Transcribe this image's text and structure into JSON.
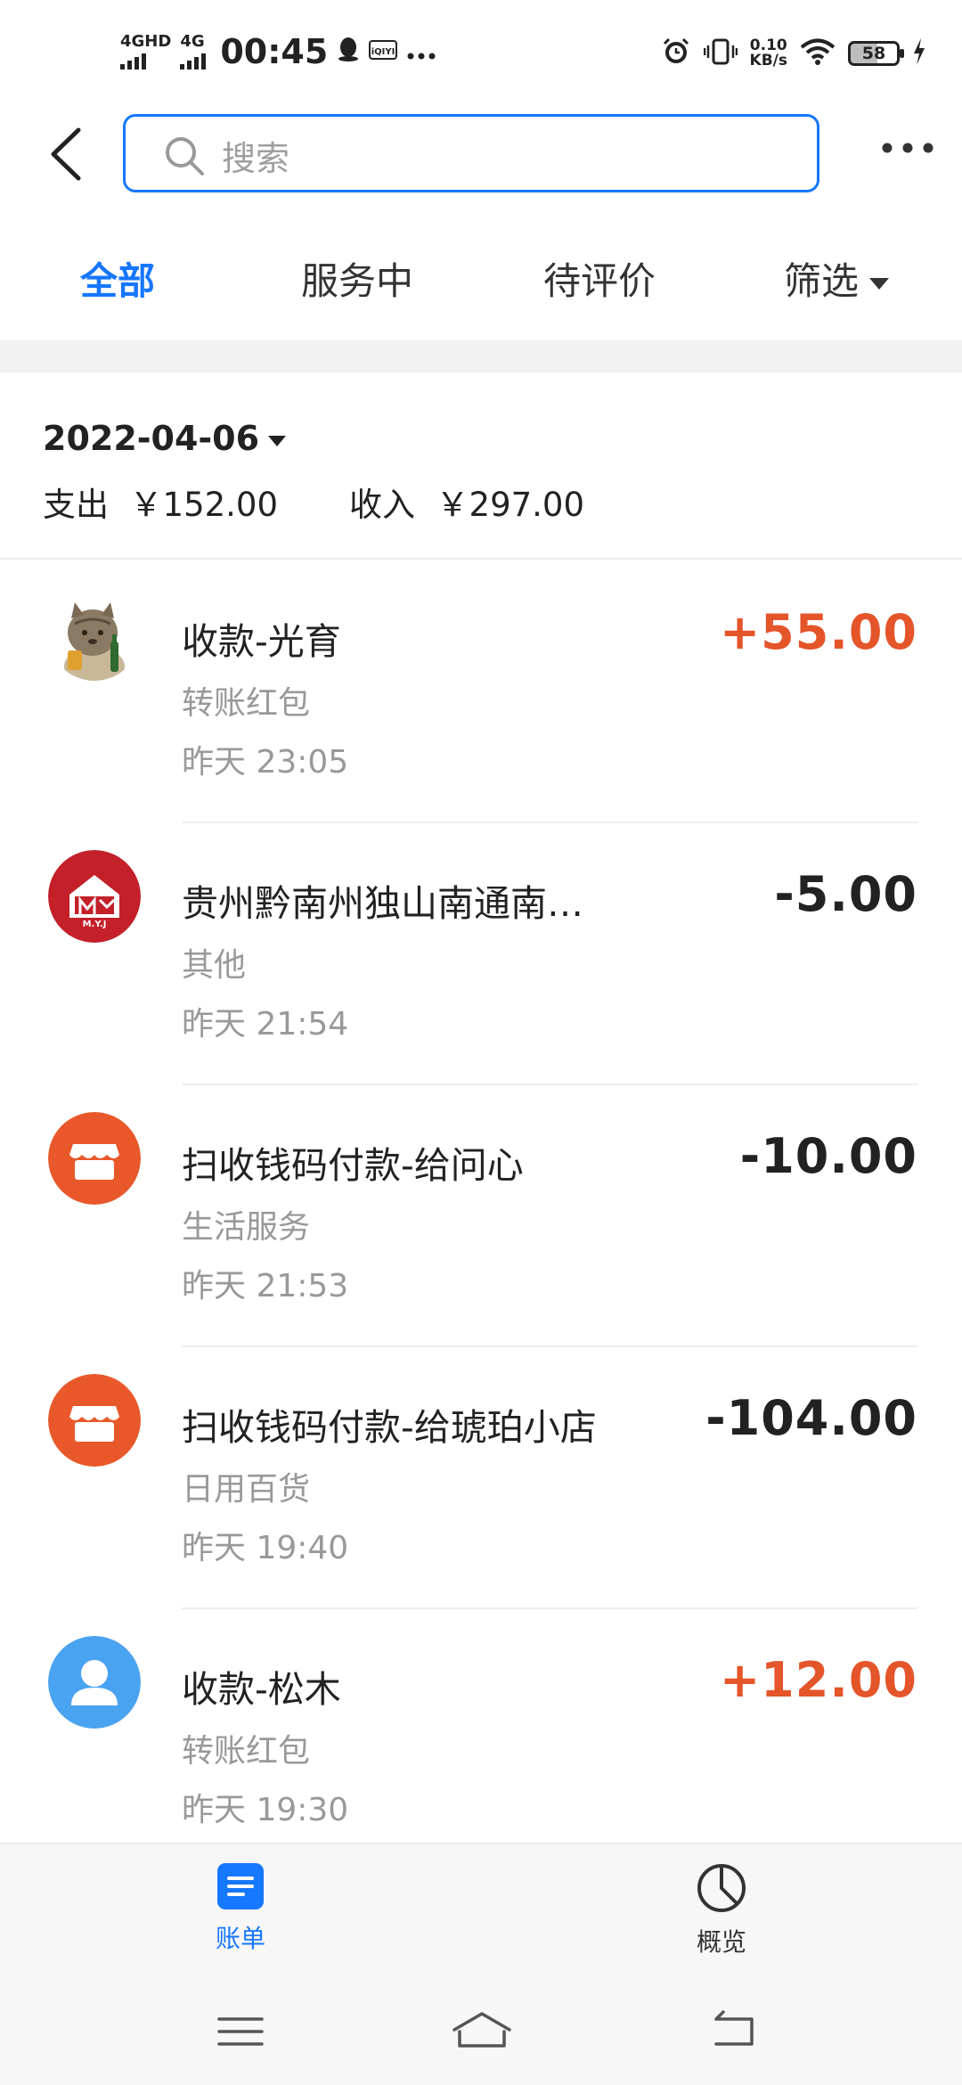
{
  "status_bar": {
    "net1": "4GHD",
    "net2": "4G",
    "time": "00:45",
    "speed_top": "0.10",
    "speed_bottom": "KB/s",
    "battery": "58"
  },
  "search": {
    "placeholder": "搜索"
  },
  "tabs": [
    {
      "label": "全部",
      "active": true
    },
    {
      "label": "服务中"
    },
    {
      "label": "待评价"
    },
    {
      "label": "筛选"
    }
  ],
  "summary": {
    "date": "2022-04-06",
    "expense_label": "支出",
    "expense_value": "￥152.00",
    "income_label": "收入",
    "income_value": "￥297.00"
  },
  "transactions": [
    {
      "title": "收款-光育",
      "category": "转账红包",
      "time": "昨天  23:05",
      "amount": "+55.00",
      "avatar": "cat-photo"
    },
    {
      "title": "贵州黔南州独山南通南…",
      "category": "其他",
      "time": "昨天  21:54",
      "amount": "-5.00",
      "avatar": "myj-logo",
      "avatar_text": "M.Y.J"
    },
    {
      "title": "扫收钱码付款-给问心",
      "category": "生活服务",
      "time": "昨天  21:53",
      "amount": "-10.00",
      "avatar": "shop-icon"
    },
    {
      "title": "扫收钱码付款-给琥珀小店",
      "category": "日用百货",
      "time": "昨天  19:40",
      "amount": "-104.00",
      "avatar": "shop-icon"
    },
    {
      "title": "收款-松木",
      "category": "转账红包",
      "time": "昨天  19:30",
      "amount": "+12.00",
      "avatar": "user-icon"
    }
  ],
  "bottom_nav": {
    "bill_label": "账单",
    "overview_label": "概览"
  },
  "colors": {
    "accent": "#1677ff",
    "income": "#e4552a",
    "shop": "#e8582a",
    "myj": "#c3202a",
    "user": "#4aa3f0"
  }
}
